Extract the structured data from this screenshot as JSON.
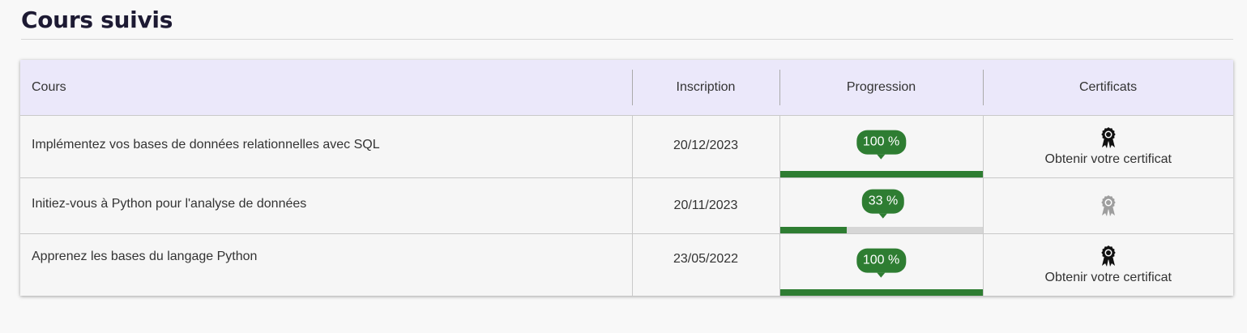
{
  "page": {
    "title": "Cours suivis"
  },
  "table": {
    "headers": {
      "course": "Cours",
      "enrollment": "Inscription",
      "progress": "Progression",
      "certificates": "Certificats"
    },
    "rows": [
      {
        "course": "Implémentez vos bases de données relationnelles avec SQL",
        "enrolled": "20/12/2023",
        "progress_label": "100 %",
        "progress": 100,
        "certificate_label": "Obtenir votre certificat",
        "certificate_icon": "medal-icon",
        "certificate_available": true
      },
      {
        "course": "Initiez-vous à Python pour l'analyse de données",
        "enrolled": "20/11/2023",
        "progress_label": "33 %",
        "progress": 33,
        "certificate_label": "",
        "certificate_icon": "medal-icon",
        "certificate_available": false
      },
      {
        "course": "Apprenez les bases du langage Python",
        "enrolled": "23/05/2022",
        "progress_label": "100 %",
        "progress": 100,
        "certificate_label": "Obtenir votre certificat",
        "certificate_icon": "medal-icon",
        "certificate_available": true
      }
    ]
  },
  "colors": {
    "accent": "#2e7d32",
    "header_bg": "#ebe8fa",
    "title": "#1d1a33",
    "medal_active": "#111111",
    "medal_inactive": "#9e9e9e"
  }
}
